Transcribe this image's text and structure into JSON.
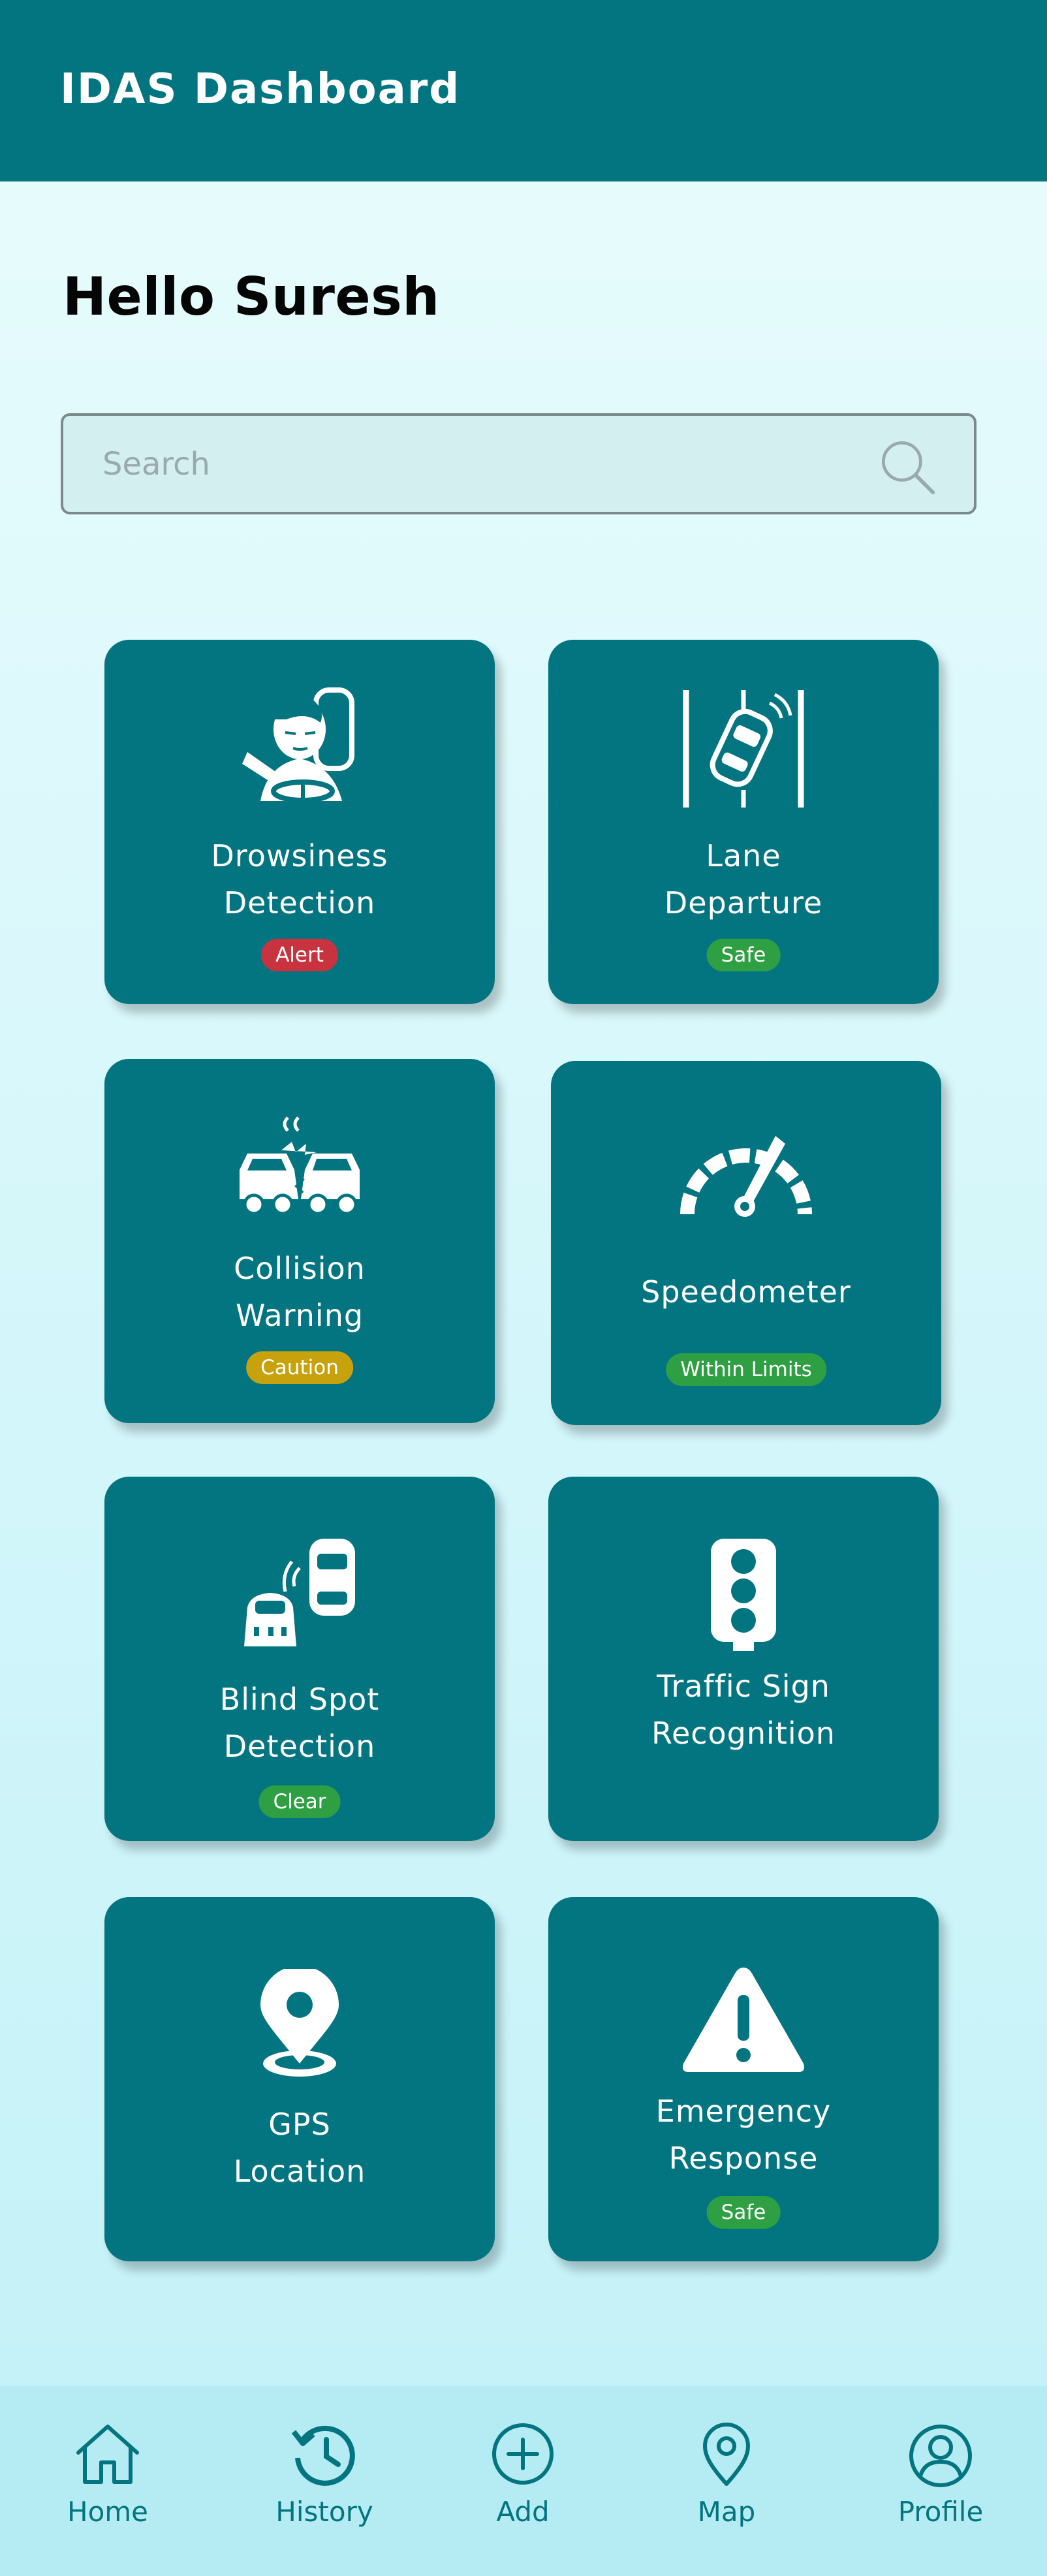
{
  "header": {
    "title": "IDAS Dashboard"
  },
  "greeting": "Hello Suresh",
  "search": {
    "placeholder": "Search",
    "value": ""
  },
  "colors": {
    "primary": "#037580",
    "alert": "#c8333f",
    "safe": "#2ea043",
    "caution": "#c7a20c"
  },
  "cards": [
    {
      "title_line1": "Drowsiness",
      "title_line2": "Detection",
      "status": "Alert",
      "status_type": "alert",
      "icon": "drowsy-driver-icon"
    },
    {
      "title_line1": "Lane",
      "title_line2": "Departure",
      "status": "Safe",
      "status_type": "safe",
      "icon": "lane-departure-icon"
    },
    {
      "title_line1": "Collision",
      "title_line2": "Warning",
      "status": "Caution",
      "status_type": "caution",
      "icon": "collision-icon"
    },
    {
      "title_line1": "Speedometer",
      "title_line2": "",
      "status": "Within Limits",
      "status_type": "safe",
      "icon": "speedometer-icon"
    },
    {
      "title_line1": "Blind Spot",
      "title_line2": "Detection",
      "status": "Clear",
      "status_type": "safe",
      "icon": "blind-spot-icon"
    },
    {
      "title_line1": "Traffic Sign",
      "title_line2": "Recognition",
      "status": "",
      "status_type": "",
      "icon": "traffic-light-icon"
    },
    {
      "title_line1": "GPS",
      "title_line2": "Location",
      "status": "",
      "status_type": "",
      "icon": "location-pin-icon"
    },
    {
      "title_line1": "Emergency",
      "title_line2": "Response",
      "status": "Safe",
      "status_type": "safe",
      "icon": "warning-triangle-icon"
    }
  ],
  "nav": [
    {
      "label": "Home",
      "icon": "home-icon"
    },
    {
      "label": "History",
      "icon": "history-icon"
    },
    {
      "label": "Add",
      "icon": "add-icon"
    },
    {
      "label": "Map",
      "icon": "map-pin-icon"
    },
    {
      "label": "Profile",
      "icon": "profile-icon"
    }
  ]
}
